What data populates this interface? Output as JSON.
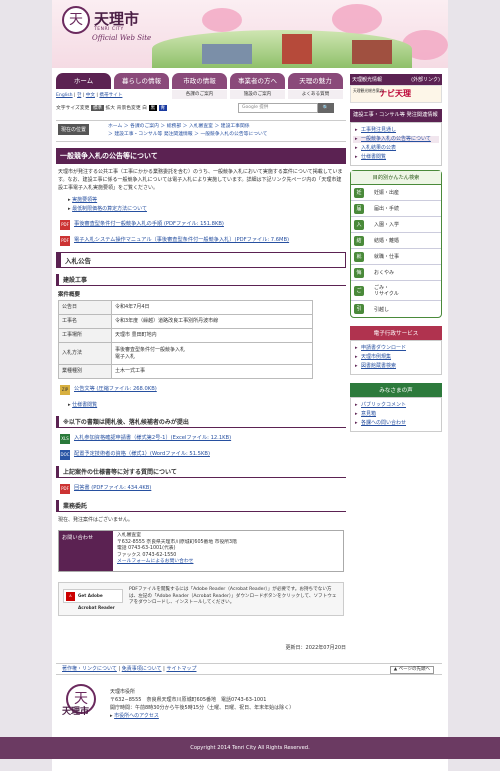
{
  "header": {
    "logo_title": "天理市",
    "logo_roman": "TENRI CITY",
    "logo_sub": "Official Web Site",
    "logo_mark": "天"
  },
  "side_top": {
    "label": "天理観光情報",
    "ext": "(外部リンク)",
    "navi_small": "天理観光総合案内",
    "navi_title": "ナビ天理"
  },
  "global_nav": [
    {
      "label": "ホーム",
      "sub": ""
    },
    {
      "label": "暮らしの情報",
      "sub": "各課のご案内"
    },
    {
      "label": "市政の情報",
      "sub": "施設のご案内"
    },
    {
      "label": "事業者の方へ",
      "sub": "よくある質問"
    },
    {
      "label": "天理の魅力",
      "sub": ""
    }
  ],
  "util": {
    "english": "English",
    "korean": "한",
    "chinese": "中文",
    "mobile": "携帯サイト"
  },
  "tools": {
    "font_label": "文字サイズ変更",
    "font_std": "標準",
    "font_big": "拡大",
    "bg_label": "背景色変更",
    "bg_w": "白",
    "bg_k": "黒",
    "bg_b": "青",
    "search_placeholder": "Google 提供",
    "search_btn": "🔍"
  },
  "breadcrumb": {
    "label": "現在の位置",
    "line1": "ホーム ＞ 各課のご案内 ＞ 総務部 ＞ 入札審査室 ＞ 建設工事関係",
    "line2": "＞ 建設工事・コンサル等 発注関連情報 ＞ 一般競争入札の公告等について"
  },
  "main": {
    "title": "一般競争入札の公告等について",
    "intro": "天理市が発注する公共工事（工事にかかる業務委託を含む）のうち、一般競争入札において実施する案件について掲載しています。なお、建設工事に係る一般競争入札については電子入札により実施しています。詳細は下記リンク先ページ内の「天理市建設工事電子入札実施要領」をご覧ください。",
    "links": [
      "実施要領等",
      "最低制限価格の算定方法について"
    ],
    "pdf1": "事後審査型条件付一般競争入札の手順 (PDFファイル: 151.8KB)",
    "pdf2": "電子入札システム操作マニュアル（事後審査型条件付一般競争入札）(PDFファイル: 7.6MB)",
    "h_notice": "入札公告",
    "h_construction": "建設工事",
    "h_overview": "案件概要",
    "table": [
      {
        "k": "公告日",
        "v": "令和4年7月4日"
      },
      {
        "k": "工事名",
        "v": "令和3年度（繰越）道路改良工事別所丹波市線"
      },
      {
        "k": "工事場所",
        "v": "天理市 豊田町地内"
      },
      {
        "k": "入札方法",
        "v": "事後審査型条件付一般競争入札\n電子入札"
      },
      {
        "k": "業種種別",
        "v": "土木一式工事"
      }
    ],
    "zip": "公告文等 (圧縮ファイル: 268.0KB)",
    "spec": "仕様書閲覧",
    "h_submit": "※以下の書類は開札後、落札候補者のみが提出",
    "xls": "入札参加資格確認申請書（様式第2号-1）(Excelファイル: 12.1KB)",
    "doc": "配置予定技術者の資格（様式1）(Wordファイル: 51.5KB)",
    "h_qa": "上記案件の仕様書等に対する質問について",
    "qa_pdf": "回答書 (PDFファイル: 434.4KB)",
    "h_mgmt": "業務委託",
    "mgmt_text": "現在、発注案件はございません。",
    "contact_key": "お問い合わせ",
    "contact": [
      "入札審査室",
      "〒632-8555 奈良県天理市川原城町605番地 市役所3階",
      "電話 0743-63-1001(代表)",
      "ファックス 0743-62-1550"
    ],
    "contact_link": "メールフォームによるお問い合わせ",
    "adobe_badge": "Get Adobe Acrobat Reader",
    "adobe_text": "PDFファイルを閲覧するには「Adobe Reader（Acrobat Reader）」が必要です。お持ちでない方は、左記の「Adobe Reader（Acrobat Reader）」ダウンロードボタンをクリックして、ソフトウェアをダウンロードし、インストールしてください。",
    "updated": "更新日：2022年07月20日"
  },
  "side": {
    "head": "建設工事・コンサル等 発注関連情報",
    "items": [
      "工事発注見通し",
      "一般競争入札の公告等について",
      "入札結果の公表",
      "仕様書閲覧"
    ],
    "purpose_head": "目的別かんたん検索",
    "purpose": [
      {
        "icon": "妊",
        "label": "妊娠・出産"
      },
      {
        "icon": "届",
        "label": "届出・手続"
      },
      {
        "icon": "入",
        "label": "入園・入学"
      },
      {
        "icon": "結",
        "label": "結婚・離婚"
      },
      {
        "icon": "就",
        "label": "就職・仕事"
      },
      {
        "icon": "悔",
        "label": "おくやみ"
      },
      {
        "icon": "ご",
        "label": "ごみ・\nリサイクル"
      },
      {
        "icon": "引",
        "label": "引越し"
      }
    ],
    "e_head": "電子行政サービス",
    "e_items": [
      "申請書ダウンロード",
      "天理市例規集",
      "図書館蔵書検索"
    ],
    "v_head": "みなさまの声",
    "v_items": [
      "パブリックコメント",
      "意見箱",
      "各課への問い合わせ"
    ]
  },
  "footer": {
    "policy": "著作権・リンクについて",
    "access": "免責事項について",
    "sitemap": "サイトマップ",
    "top": "▲ ページの先頭へ",
    "org": "天理市役所",
    "addr": "〒632−8555　奈良県天理市川原城町605番地　電話0743-63-1001",
    "hours": "開庁時間：午前8時30分から午後5時15分（土曜、日曜、祝日、年末年始は除く）",
    "access_link": "市役所へのアクセス",
    "name": "天理市",
    "copyright": "Copyright 2014 Tenri City All Rights Reserved."
  }
}
